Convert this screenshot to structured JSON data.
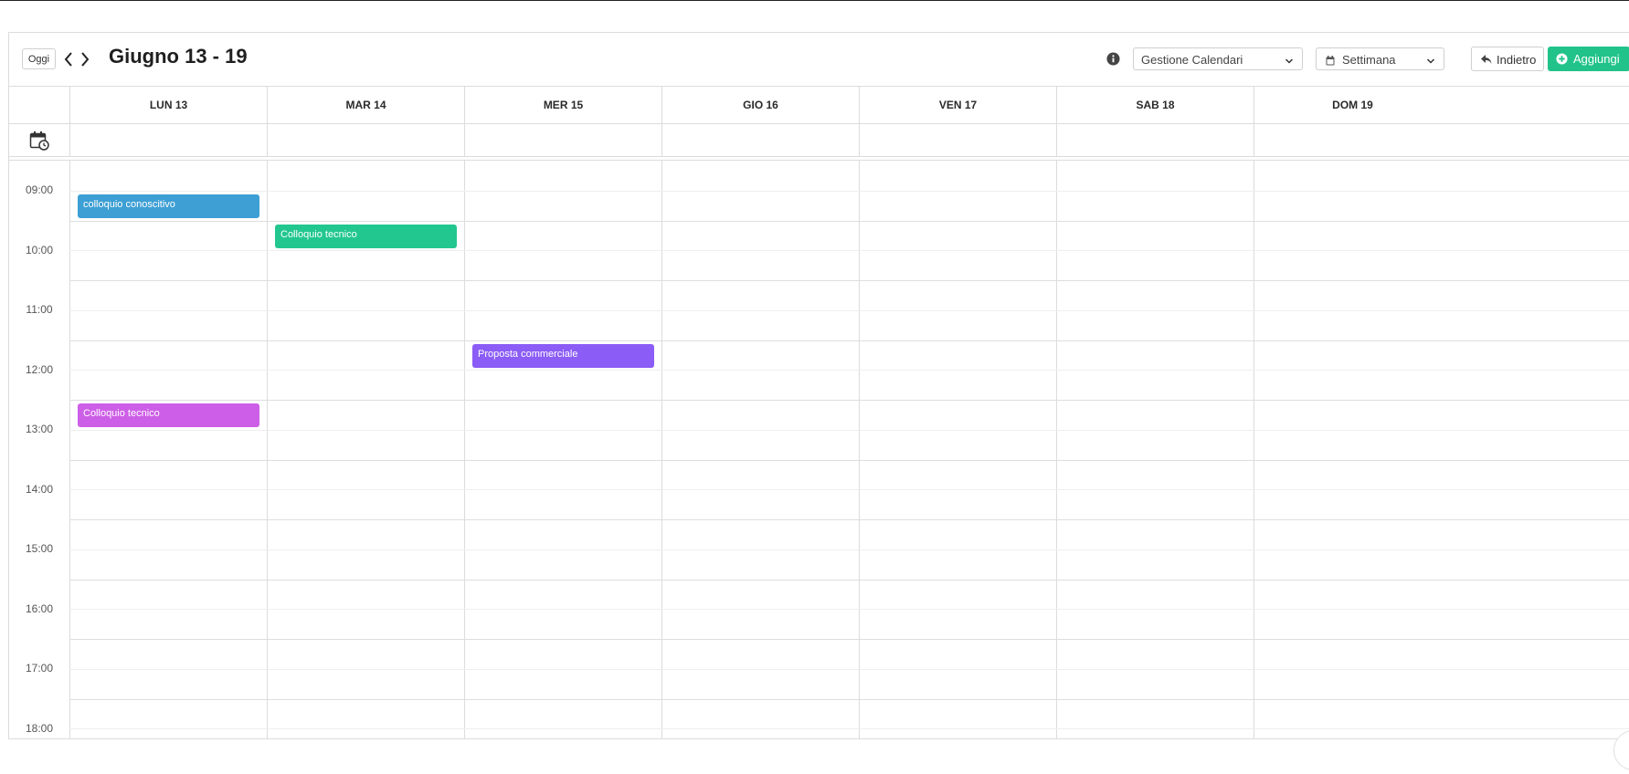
{
  "toolbar": {
    "today_label": "Oggi",
    "prev_icon": "chevron-left-icon",
    "next_icon": "chevron-right-icon",
    "period_title": "Giugno 13 - 19",
    "info_icon": "info-icon",
    "calendar_select": {
      "value": "Gestione Calendari"
    },
    "view_select": {
      "value": "Settimana",
      "icon": "calendar-icon"
    },
    "back_label": "Indietro",
    "add_label": "Aggiungi",
    "accent_color": "#21c38b"
  },
  "days": [
    {
      "label": "LUN 13"
    },
    {
      "label": "MAR 14"
    },
    {
      "label": "MER 15"
    },
    {
      "label": "GIO 16"
    },
    {
      "label": "VEN 17"
    },
    {
      "label": "SAB 18"
    },
    {
      "label": "DOM 19"
    }
  ],
  "allday_icon": "calendar-clock-icon",
  "hours": [
    "09:00",
    "10:00",
    "11:00",
    "12:00",
    "13:00",
    "14:00",
    "15:00",
    "16:00",
    "17:00",
    "18:00"
  ],
  "events": [
    {
      "title": "colloquio conoscitivo",
      "day": 0,
      "start": "09:30",
      "color": "#3d9fd4"
    },
    {
      "title": "Colloquio tecnico",
      "day": 1,
      "start": "10:00",
      "color": "#22c790"
    },
    {
      "title": "Proposta commerciale",
      "day": 2,
      "start": "12:00",
      "color": "#8b5cf6"
    },
    {
      "title": "Colloquio tecnico",
      "day": 0,
      "start": "13:00",
      "color": "#cd5ee7"
    }
  ]
}
